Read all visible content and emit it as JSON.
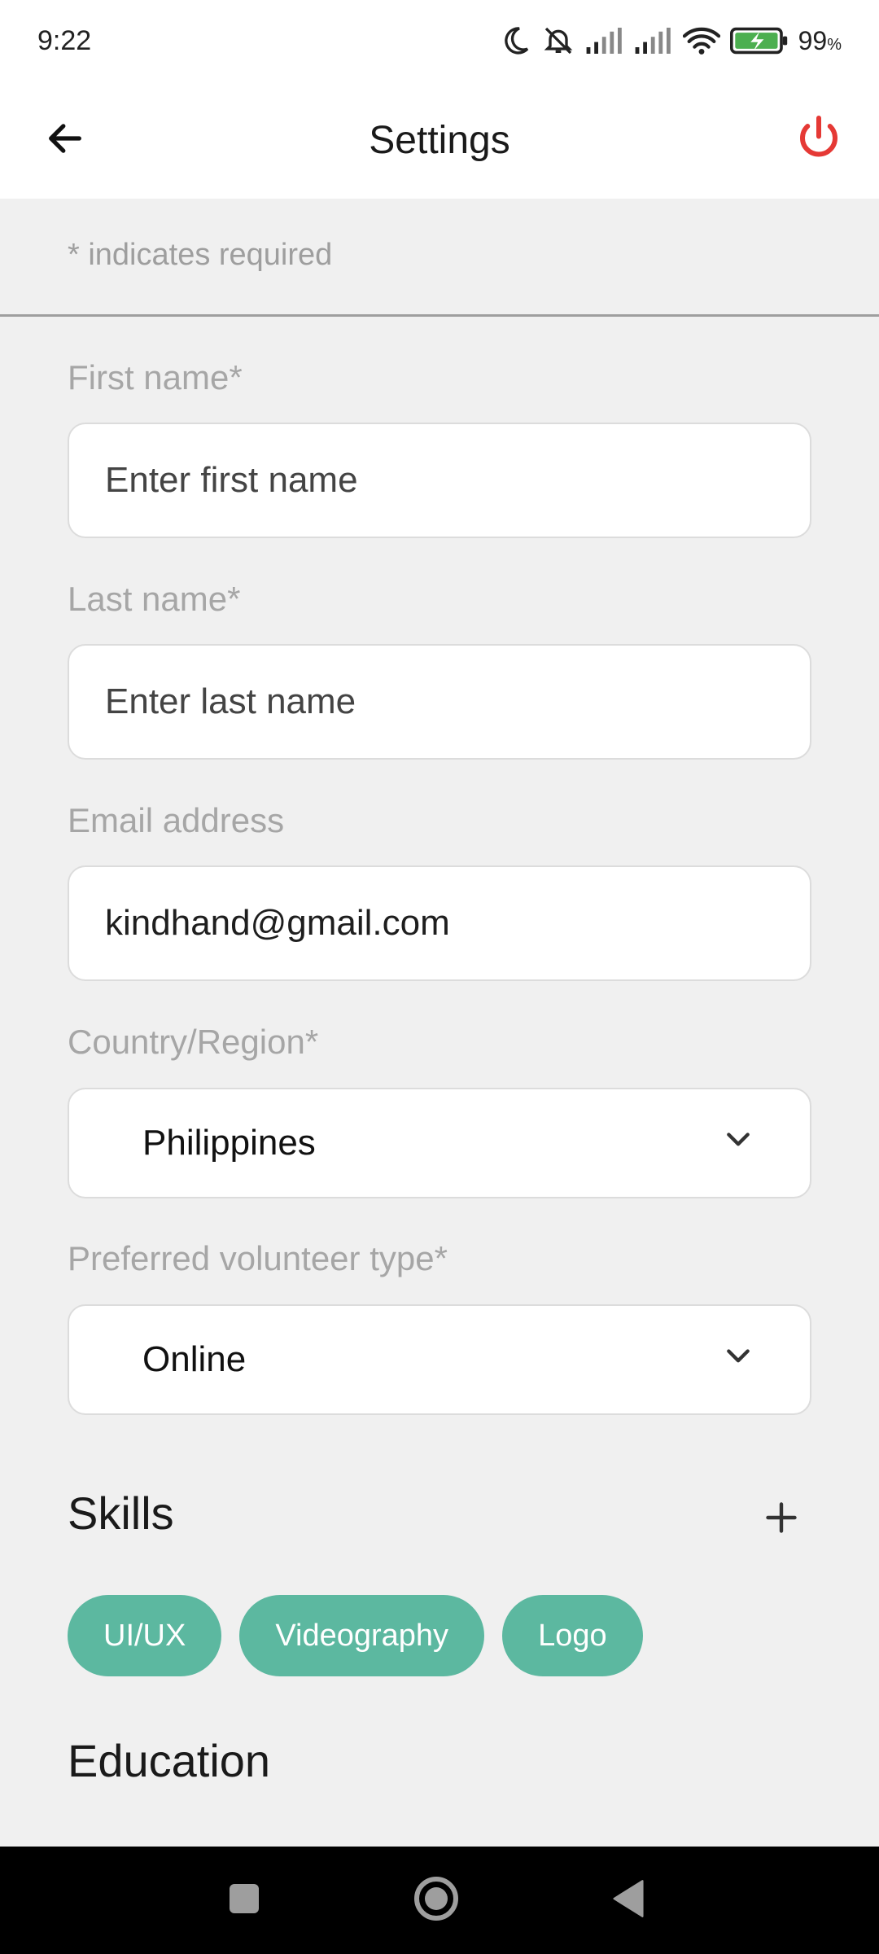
{
  "status_bar": {
    "time": "9:22",
    "battery_percent": "99",
    "battery_unit": "%",
    "icons": [
      "moon-icon",
      "bell-muted-icon",
      "signal-icon",
      "signal-icon",
      "wifi-icon",
      "battery-charging-icon"
    ]
  },
  "app_bar": {
    "title": "Settings",
    "back_icon": "arrow-left-icon",
    "power_icon": "power-icon",
    "power_color": "#e53935"
  },
  "form": {
    "required_note": "* indicates required",
    "first_name": {
      "label": "First name*",
      "placeholder": "Enter first name",
      "value": ""
    },
    "last_name": {
      "label": "Last name*",
      "placeholder": "Enter last name",
      "value": ""
    },
    "email": {
      "label": "Email address",
      "value": "kindhand@gmail.com"
    },
    "country": {
      "label": "Country/Region*",
      "selected": "Philippines"
    },
    "volunteer_type": {
      "label": "Preferred volunteer type*",
      "selected": "Online"
    }
  },
  "skills": {
    "heading": "Skills",
    "add_icon": "plus-icon",
    "items": [
      "UI/UX",
      "Videography",
      "Logo"
    ],
    "chip_color": "#5cb8a0"
  },
  "education": {
    "heading": "Education"
  },
  "nav_bar": {
    "icons": [
      "square-icon",
      "home-circle-icon",
      "back-triangle-icon"
    ]
  }
}
